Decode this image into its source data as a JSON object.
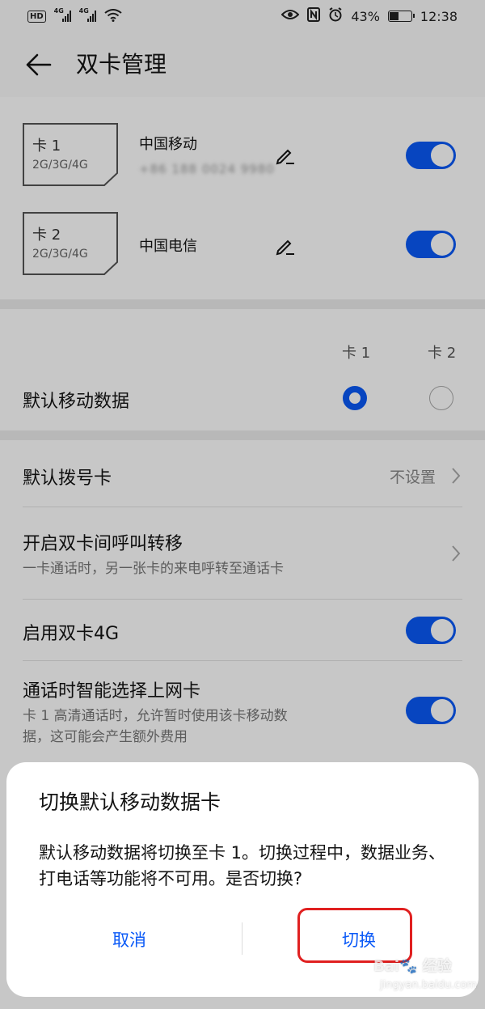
{
  "status_bar": {
    "hd_label": "HD",
    "sim1_tag": "4G",
    "sim2_tag": "4G",
    "battery": "43%",
    "battery_level": 0.43,
    "time": "12:38"
  },
  "header": {
    "title": "双卡管理"
  },
  "sim_cards": [
    {
      "card": "卡 1",
      "network": "2G/3G/4G",
      "carrier": "中国移动",
      "number": "+86 188 0024 9980",
      "enabled": true
    },
    {
      "card": "卡 2",
      "network": "2G/3G/4G",
      "carrier": "中国电信",
      "enabled": true
    }
  ],
  "default_data": {
    "label": "默认移动数据",
    "col1": "卡 1",
    "col2": "卡 2",
    "selected": "卡 1"
  },
  "settings": {
    "default_dial": {
      "label": "默认拨号卡",
      "value": "不设置"
    },
    "call_forward": {
      "label": "开启双卡间呼叫转移",
      "subtitle": "一卡通话时，另一张卡的来电呼转至通话卡"
    },
    "dual_4g": {
      "label": "启用双卡4G",
      "enabled": true
    },
    "smart_data": {
      "label": "通话时智能选择上网卡",
      "subtitle_line1": "卡 1 高清通话时，允许暂时使用该卡移动数",
      "subtitle_line2": "据，这可能会产生额外费用",
      "enabled": true
    }
  },
  "dialog": {
    "title": "切换默认移动数据卡",
    "message": "默认移动数据将切换至卡 1。切换过程中，数据业务、打电话等功能将不可用。是否切换?",
    "cancel_label": "取消",
    "confirm_label": "切换"
  },
  "watermark": {
    "brand": "Bai🐾 经验",
    "url": "jingyan.baidu.com"
  },
  "colors": {
    "accent": "#0a59f7",
    "highlight": "#e02020"
  }
}
